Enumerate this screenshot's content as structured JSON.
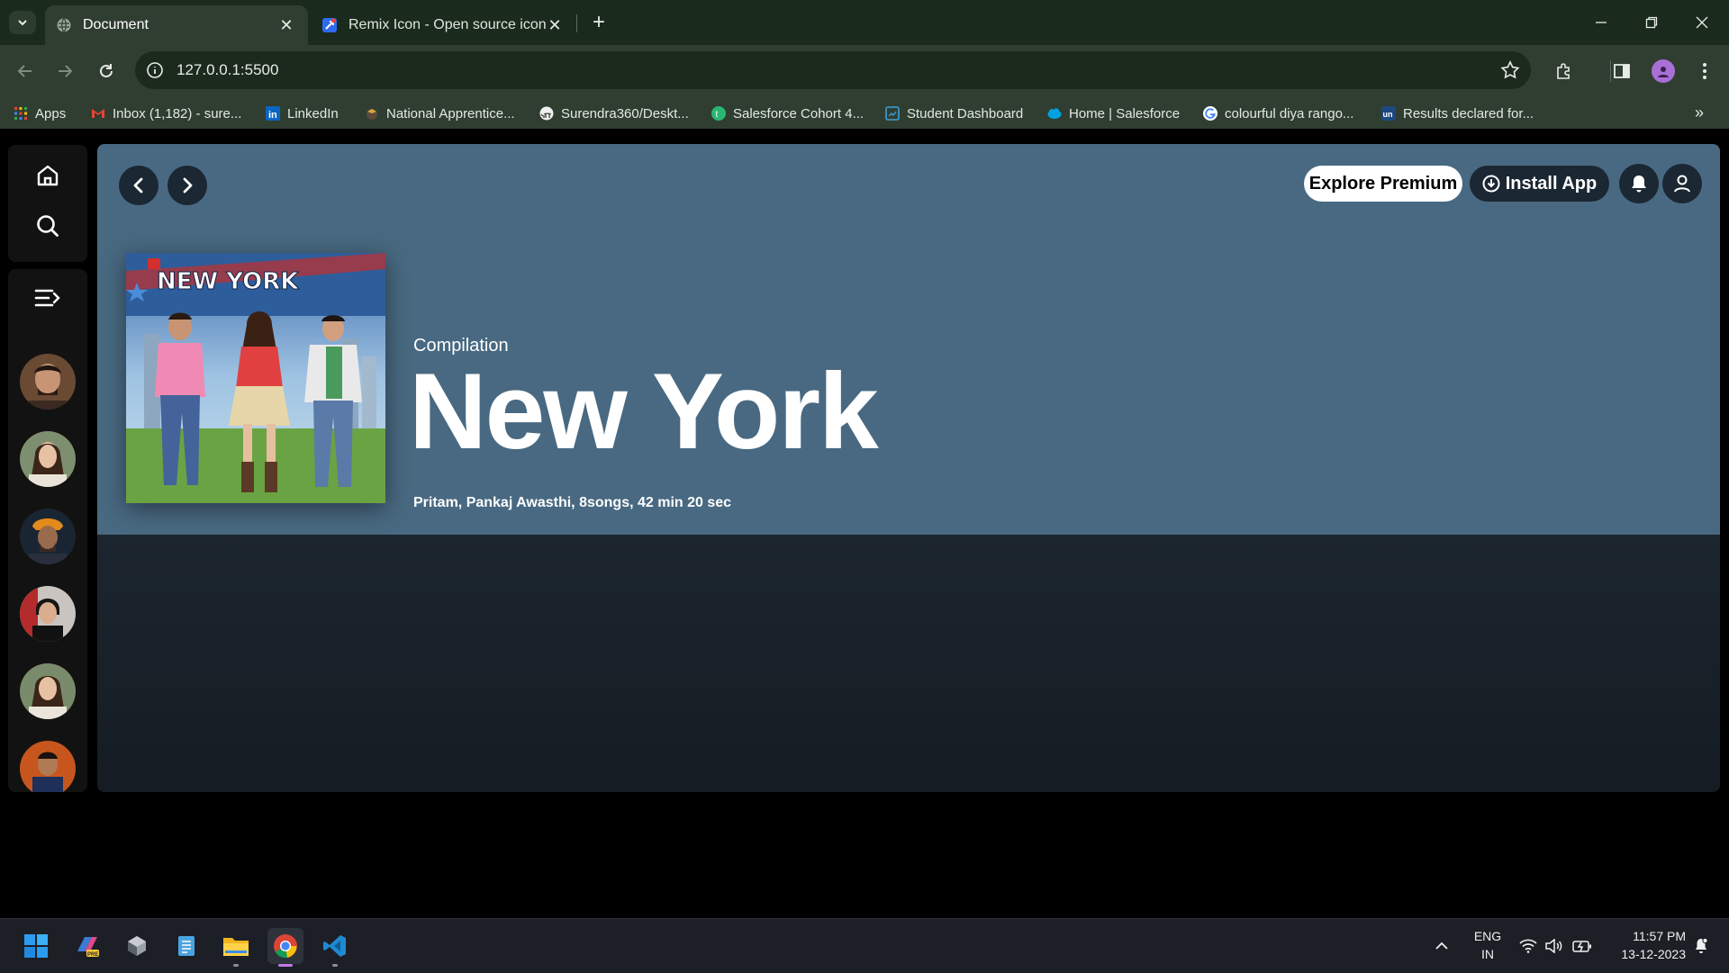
{
  "browser": {
    "tabs": [
      {
        "title": "Document",
        "active": true
      },
      {
        "title": "Remix Icon - Open source icon library",
        "active": false
      }
    ],
    "url": "127.0.0.1:5500",
    "bookmarks": [
      {
        "label": "Apps",
        "icon": "apps-grid-icon"
      },
      {
        "label": "Inbox (1,182) - sure...",
        "icon": "gmail-icon"
      },
      {
        "label": "LinkedIn",
        "icon": "linkedin-icon"
      },
      {
        "label": "National Apprentice...",
        "icon": "apprentice-icon"
      },
      {
        "label": "Surendra360/Deskt...",
        "icon": "github-icon"
      },
      {
        "label": "Salesforce Cohort 4...",
        "icon": "trailhead-icon"
      },
      {
        "label": "Student Dashboard",
        "icon": "dashboard-icon"
      },
      {
        "label": "Home | Salesforce",
        "icon": "salesforce-icon"
      },
      {
        "label": "colourful diya rango...",
        "icon": "google-icon"
      },
      {
        "label": "Results declared for...",
        "icon": "unstop-icon"
      }
    ]
  },
  "app": {
    "header": {
      "explore_label": "Explore Premium",
      "install_label": "Install App"
    },
    "album": {
      "type": "Compilation",
      "title": "New York",
      "meta": "Pritam, Pankaj Awasthi, 8songs, 42 min 20 sec",
      "cover_text": "NEW YORK"
    }
  },
  "taskbar": {
    "language": "ENG",
    "region": "IN",
    "time": "11:57 PM",
    "date": "13-12-2023"
  },
  "colors": {
    "hero": "#486981",
    "chrome_tab": "#2f3e31",
    "accent_profile": "#a86fd6"
  }
}
